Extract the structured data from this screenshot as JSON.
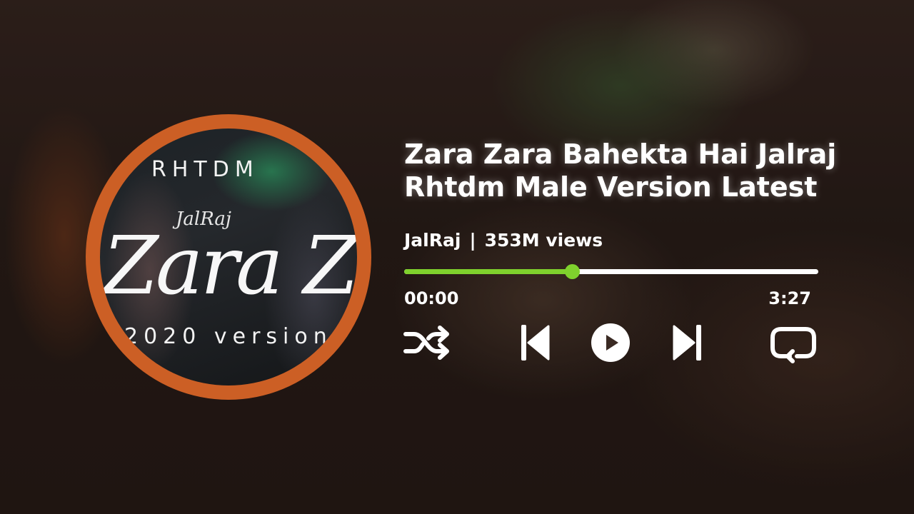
{
  "album_art": {
    "top_text": "RHTDM",
    "script_small": "JalRaj",
    "script_title": "Zara Zara",
    "bottom_text": "2020 version"
  },
  "track": {
    "title": "Zara Zara Bahekta Hai Jalraj Rhtdm Male Version Latest",
    "artist": "JalRaj",
    "separator": "|",
    "views": "353M views"
  },
  "playback": {
    "current_time": "00:00",
    "total_time": "3:27",
    "progress_fraction": 0.405
  },
  "controls": {
    "shuffle_icon": "shuffle-icon",
    "previous_icon": "skip-previous-icon",
    "play_icon": "play-icon",
    "next_icon": "skip-next-icon",
    "repeat_icon": "repeat-icon"
  },
  "colors": {
    "accent": "#7fd12d",
    "ring": "#cc5f25",
    "text": "#ffffff",
    "track": "#ffffff"
  }
}
